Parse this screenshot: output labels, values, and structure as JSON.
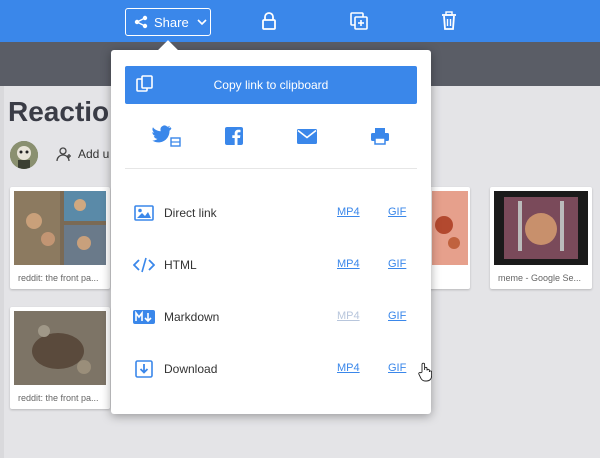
{
  "toolbar": {
    "share_label": "Share",
    "icons": [
      "share-icon",
      "chevron-down-icon",
      "lock-icon",
      "copy-add-icon",
      "trash-icon"
    ]
  },
  "page": {
    "title": "Reaction",
    "add_user_label": "Add u"
  },
  "thumbnails": [
    {
      "caption": "reddit: the front pa..."
    },
    {
      "caption": "reddit: the front pa..."
    },
    {
      "caption": "meme - Google Se..."
    }
  ],
  "share_popup": {
    "copy_label": "Copy link to clipboard",
    "social": [
      "twitter-icon",
      "facebook-icon",
      "email-icon",
      "print-icon"
    ],
    "rows": [
      {
        "label": "Direct link",
        "mp4": "MP4",
        "gif": "GIF",
        "icon": "image-icon",
        "mp4_enabled": true
      },
      {
        "label": "HTML",
        "mp4": "MP4",
        "gif": "GIF",
        "icon": "code-icon",
        "mp4_enabled": true
      },
      {
        "label": "Markdown",
        "mp4": "MP4",
        "gif": "GIF",
        "icon": "markdown-icon",
        "mp4_enabled": false
      },
      {
        "label": "Download",
        "mp4": "MP4",
        "gif": "GIF",
        "icon": "download-icon",
        "mp4_enabled": true
      }
    ]
  },
  "colors": {
    "accent": "#3a87ea",
    "disabled_link": "#b8c6dc",
    "band": "#5a5d66"
  }
}
